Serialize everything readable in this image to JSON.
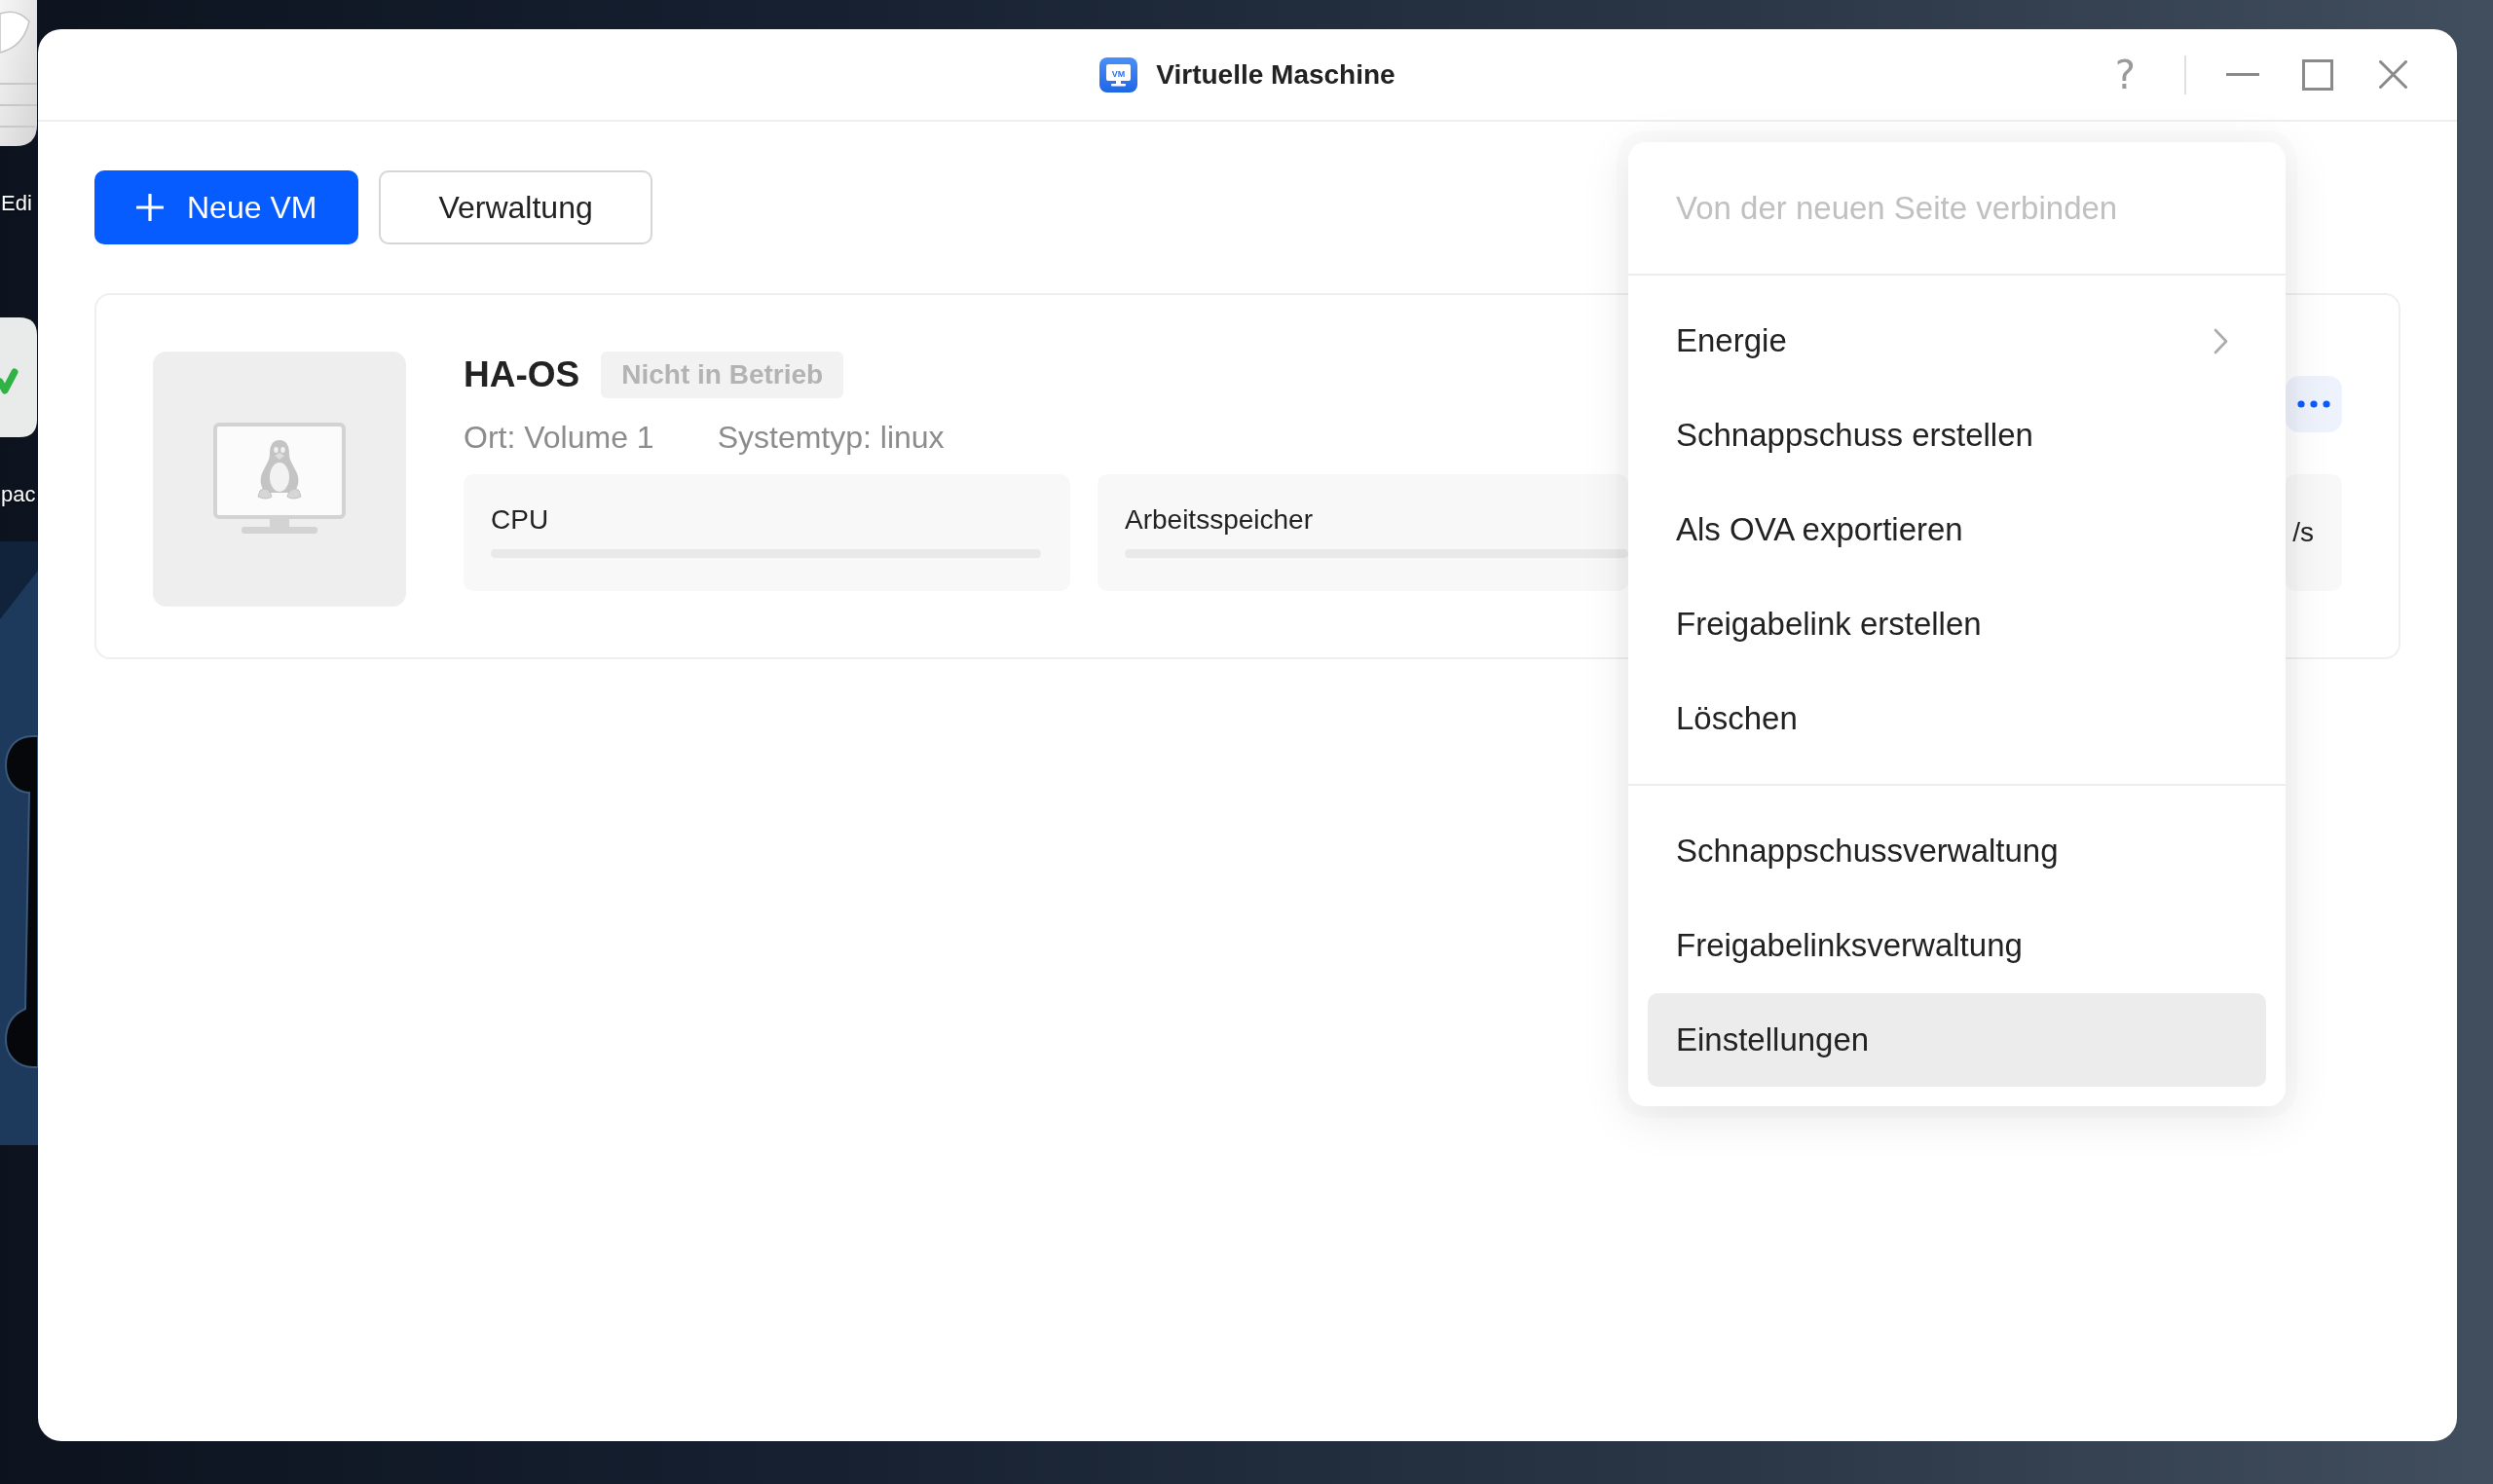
{
  "desktop": {
    "icons": [
      {
        "kind": "notepad",
        "label": "Edi"
      },
      {
        "kind": "check",
        "label": "pac"
      }
    ]
  },
  "window": {
    "title": "Virtuelle Maschine",
    "logo_text": "VM",
    "help": "?"
  },
  "toolbar": {
    "buttons": [
      {
        "kind": "primary",
        "label": "Neue VM"
      },
      {
        "kind": "secondary",
        "label": "Verwaltung"
      }
    ]
  },
  "vms": [
    {
      "name": "HA-OS",
      "running": false,
      "status": "Nicht in Betrieb",
      "details": [
        "Ort: Volume 1",
        "Systemtyp: linux"
      ],
      "metrics": [
        {
          "kind": "usage",
          "label": "CPU",
          "level": 0
        },
        {
          "kind": "usage",
          "label": "Arbeitsspeicher",
          "level": 0
        },
        {
          "kind": "rate",
          "reading": "/s"
        }
      ]
    }
  ],
  "context_menu": {
    "sections": [
      {
        "items": [
          {
            "label": "Von der neuen Seite verbinden",
            "disabled": true,
            "submenu": false,
            "highlighted": false
          }
        ]
      },
      {
        "items": [
          {
            "label": "Energie",
            "disabled": false,
            "submenu": true,
            "highlighted": false
          },
          {
            "label": "Schnappschuss erstellen",
            "disabled": false,
            "submenu": false,
            "highlighted": false
          },
          {
            "label": "Als OVA exportieren",
            "disabled": false,
            "submenu": false,
            "highlighted": false
          },
          {
            "label": "Freigabelink erstellen",
            "disabled": false,
            "submenu": false,
            "highlighted": false
          },
          {
            "label": "Löschen",
            "disabled": false,
            "submenu": false,
            "highlighted": false
          }
        ]
      },
      {
        "items": [
          {
            "label": "Schnappschussverwaltung",
            "disabled": false,
            "submenu": false,
            "highlighted": false
          },
          {
            "label": "Freigabelinksverwaltung",
            "disabled": false,
            "submenu": false,
            "highlighted": false
          },
          {
            "label": "Einstellungen",
            "disabled": false,
            "submenu": false,
            "highlighted": true
          }
        ]
      }
    ]
  }
}
